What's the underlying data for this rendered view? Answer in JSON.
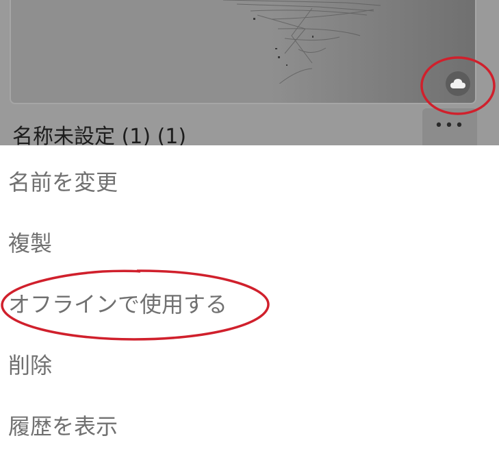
{
  "document": {
    "title": "名称未設定 (1) (1)",
    "more_label": "•••",
    "sync_icon": "cloud-icon"
  },
  "menu": {
    "items": [
      {
        "id": "rename",
        "label": "名前を変更"
      },
      {
        "id": "duplicate",
        "label": "複製"
      },
      {
        "id": "offline",
        "label": "オフラインで使用する"
      },
      {
        "id": "delete",
        "label": "削除"
      },
      {
        "id": "history",
        "label": "履歴を表示"
      }
    ]
  },
  "colors": {
    "annotation": "#d0202c",
    "menu_text": "#707070",
    "backdrop": "#9a9a9a"
  }
}
